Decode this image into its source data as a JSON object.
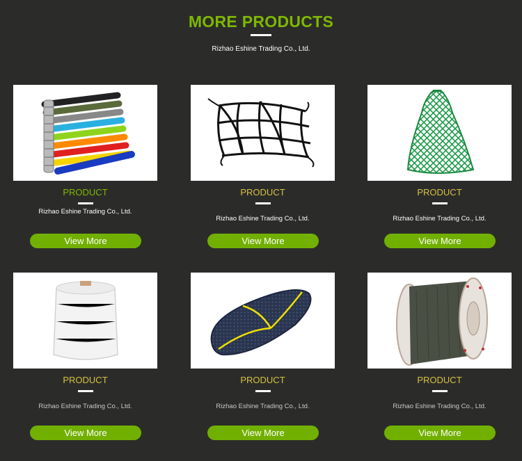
{
  "header": {
    "title": "MORE PRODUCTS",
    "subtitle": "Rizhao Eshine Trading Co., Ltd."
  },
  "colors": {
    "background": "#2b2c2a",
    "accent_green": "#7fb800",
    "button_green": "#72b000",
    "label_yellow": "#d8c040"
  },
  "products": [
    {
      "image": "ratchet-straps-image",
      "label": "PRODUCT",
      "company": "Rizhao Eshine Trading Co., Ltd.",
      "button": "View More"
    },
    {
      "image": "cargo-net-image",
      "label": "PRODUCT",
      "company": "Rizhao Eshine Trading Co., Ltd.",
      "button": "View More"
    },
    {
      "image": "hay-net-image",
      "label": "PRODUCT",
      "company": "Rizhao Eshine Trading Co., Ltd.",
      "button": "View More"
    },
    {
      "image": "twine-spool-image",
      "label": "PRODUCT",
      "company": "Rizhao Eshine Trading Co., Ltd.",
      "button": "View More"
    },
    {
      "image": "seat-cover-net-image",
      "label": "PRODUCT",
      "company": "Rizhao Eshine Trading Co., Ltd.",
      "button": "View More"
    },
    {
      "image": "wire-rope-reel-image",
      "label": "PRODUCT",
      "company": "Rizhao Eshine Trading Co., Ltd.",
      "button": "View More"
    }
  ]
}
